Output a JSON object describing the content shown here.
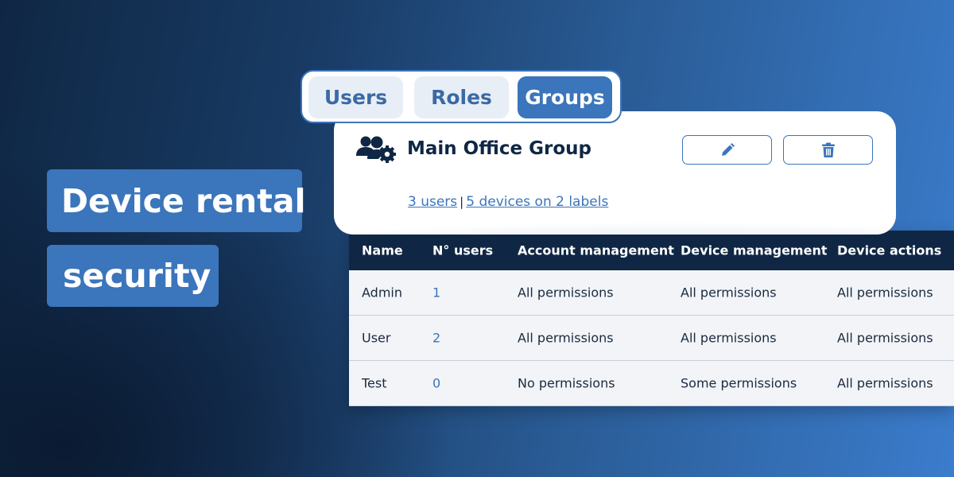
{
  "headline": {
    "line1": "Device rental",
    "line2": "security"
  },
  "tabs": [
    {
      "label": "Users"
    },
    {
      "label": "Roles"
    },
    {
      "label": "Groups",
      "active": true
    }
  ],
  "group": {
    "title": "Main Office Group",
    "icon": "users-cog-icon",
    "users_link": "3 users",
    "separator": "|",
    "devices_link": "5 devices on 2 labels"
  },
  "table": {
    "headers": [
      "Name",
      "N° users",
      "Account management",
      "Device management",
      "Device actions"
    ],
    "rows": [
      [
        "Admin",
        "1",
        "All permissions",
        "All permissions",
        "All permissions"
      ],
      [
        "User",
        "2",
        "All permissions",
        "All permissions",
        "All permissions"
      ],
      [
        "Test",
        "0",
        "No permissions",
        "Some permissions",
        "All permissions"
      ]
    ]
  },
  "colors": {
    "accent": "#3b75bb",
    "dark": "#0f2744"
  }
}
